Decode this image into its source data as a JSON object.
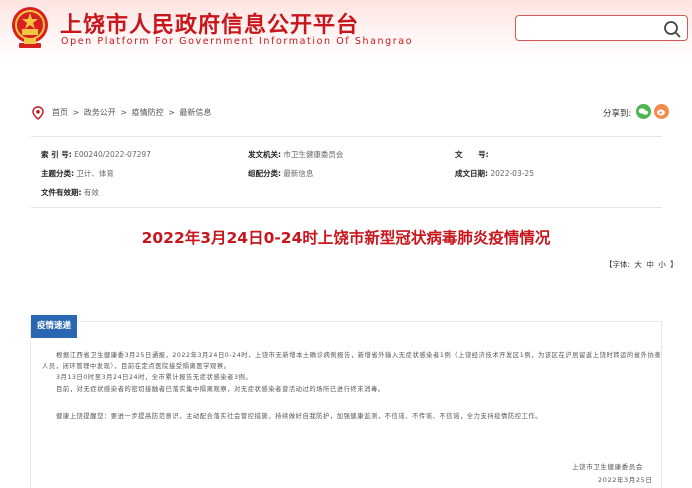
{
  "header": {
    "title": "上饶市人民政府信息公开平台",
    "subtitle": "Open Platform For Government Information Of Shangrao",
    "search": {
      "placeholder": "",
      "icon": "search-icon"
    },
    "accent_color": "#c8161d"
  },
  "breadcrumb": {
    "items": [
      "首页",
      "政务公开",
      "疫情防控",
      "最新信息"
    ],
    "separator": ">"
  },
  "share": {
    "label": "分享到:",
    "buttons": [
      "wechat-icon",
      "weibo-icon"
    ]
  },
  "meta": {
    "index_no": {
      "label": "索 引 号:",
      "value": "E00240/2022-07297"
    },
    "issuer": {
      "label": "发文机关:",
      "value": "市卫生健康委员会"
    },
    "doc_no": {
      "label": "文      号:",
      "value": ""
    },
    "topic": {
      "label": "主题分类:",
      "value": "卫计、体育"
    },
    "category": {
      "label": "组配分类:",
      "value": "最新信息"
    },
    "created": {
      "label": "成文日期:",
      "value": "2022-03-25"
    },
    "validity": {
      "label": "文件有效期:",
      "value": "有效"
    }
  },
  "article": {
    "title": "2022年3月24日0-24时上饶市新型冠状病毒肺炎疫情情况",
    "font_size_label": "【字体:",
    "font_sizes": [
      "大",
      "中",
      "小"
    ],
    "font_size_end": "】",
    "section_tab": "疫情速递",
    "paragraphs": [
      "根据江西省卫生健康委3月25日通报，2022年3月24日0-24时，上饶市无新增本土确诊病例报告，新增省外输入无症状感染者1例（上饶经济技术开发区1例，为该区在沪居留返上饶时转运的省外协查人员，闭环管理中发现），目前在定点医院接受隔离医学观察。",
      "3月13日0时至3月24日24时，全市累计报告无症状感染者3例。",
      "目前，对无症状感染者的密切接触者已落实集中隔离观察，对无症状感染者曾活动过的场所已进行终末消毒。",
      "健康上饶提醒您：要进一步提高防范意识，主动配合落实社会管控措施，持续做好自我防护，加强健康监测，不信谣、不传谣、不信谣，全力支持疫情防控工作。"
    ],
    "signature": "上饶市卫生健康委员会",
    "date": "2022年3月25日"
  }
}
